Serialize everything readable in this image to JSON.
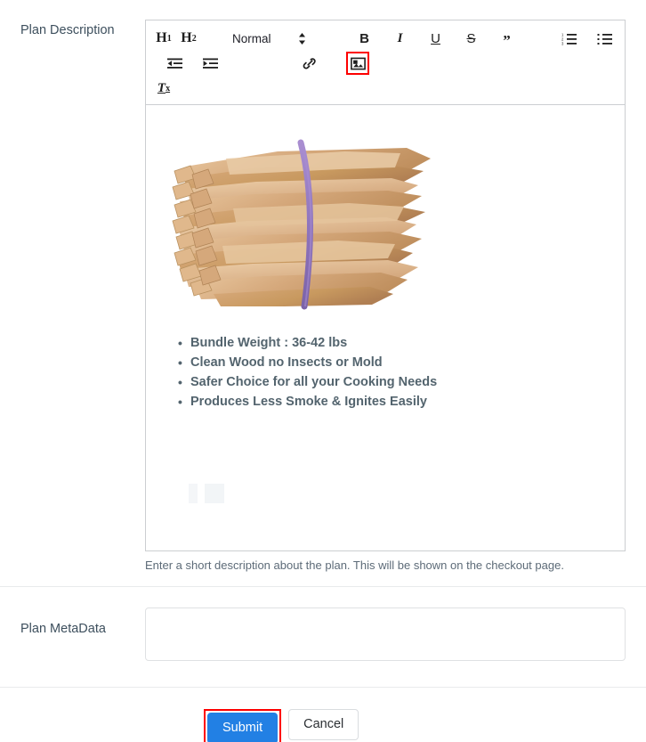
{
  "form": {
    "description_label": "Plan Description",
    "metadata_label": "Plan MetaData",
    "help_text": "Enter a short description about the plan. This will be shown on the checkout page.",
    "metadata_value": "",
    "metadata_placeholder": ""
  },
  "toolbar": {
    "h1_label": "H",
    "h1_sub": "1",
    "h2_label": "H",
    "h2_sub": "2",
    "format_value": "Normal",
    "format_options": [
      "Normal",
      "H1",
      "H2"
    ],
    "bold_label": "B",
    "italic_label": "I",
    "underline_label": "U",
    "strike_label": "S",
    "quote_label": "”",
    "clear_format_label": "T",
    "clear_format_sub": "x",
    "ordered_list_icon": "ordered-list-icon",
    "bullet_list_icon": "bullet-list-icon",
    "outdent_icon": "outdent-icon",
    "indent_icon": "indent-icon",
    "link_icon": "link-icon",
    "image_icon": "image-icon",
    "caret_icon": "updown-caret-icon",
    "highlighted_tool": "image-icon"
  },
  "editor_content": {
    "image_alt": "bundle-of-firewood-kindling-sticks",
    "bullets": [
      "Bundle Weight : 36-42 lbs",
      "Clean Wood no Insects or Mold",
      "Safer Choice for all your Cooking Needs",
      "Produces Less Smoke & Ignites Easily"
    ]
  },
  "actions": {
    "submit_label": "Submit",
    "cancel_label": "Cancel"
  },
  "colors": {
    "primary_button": "#2280e4",
    "highlight_border": "#fd0000",
    "label_text": "#3d4f5d",
    "bullet_text": "#53646e",
    "border": "#ccced1",
    "separator": "#e9ebec",
    "wood_light": "#e3bb8e",
    "wood_mid": "#cda175",
    "wood_dark": "#b07f53",
    "band_purple": "#8d74bd"
  }
}
